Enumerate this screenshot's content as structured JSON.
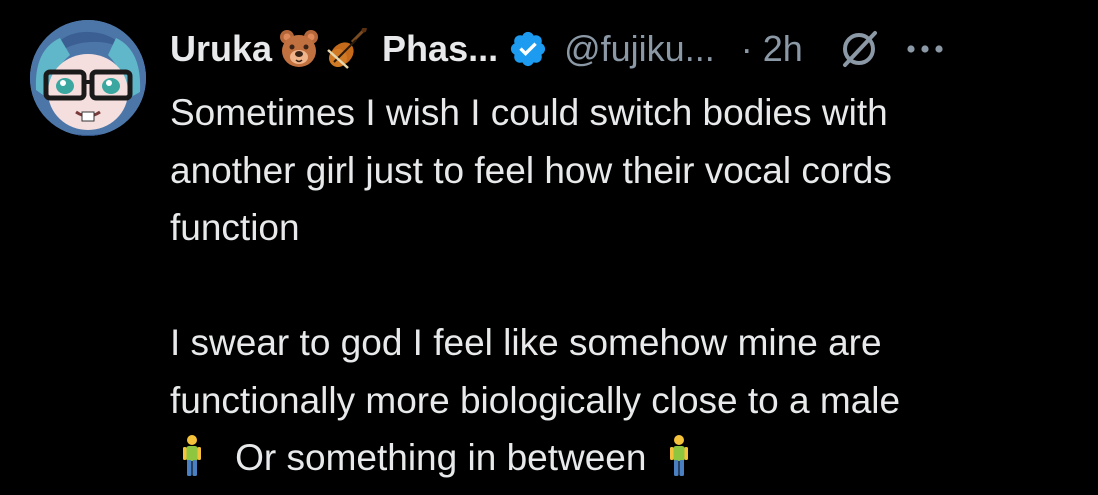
{
  "tweet": {
    "author": {
      "display_name": "Uruka",
      "display_name_suffix": "Phas...",
      "handle": "@fujiku...",
      "verified": true,
      "emojis": [
        "bear-face",
        "violin"
      ]
    },
    "separator": "·",
    "timestamp": "2h",
    "icons": [
      "muted-conversation-icon",
      "more-icon"
    ],
    "body": {
      "paragraph1": [
        "Sometimes I wish I could switch bodies with",
        "another girl just to feel how their vocal cords",
        "function"
      ],
      "paragraph2": [
        "I swear to god I feel like somehow mine are",
        "functionally more biologically close to a male"
      ],
      "last_line_text": "Or something in between"
    },
    "colors": {
      "background": "#000000",
      "text": "#e7e9ea",
      "secondary_text": "#8b98a5",
      "verified_badge": "#1d9bf0"
    }
  }
}
